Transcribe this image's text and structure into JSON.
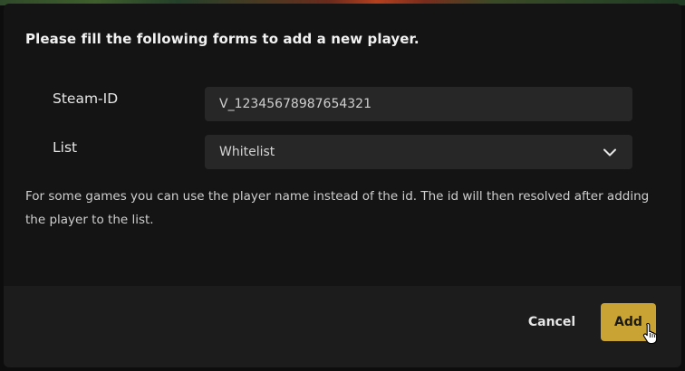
{
  "dialog": {
    "title": "Please fill the following forms to add a new player.",
    "steam_id": {
      "label": "Steam-ID",
      "value": "V_12345678987654321"
    },
    "list": {
      "label": "List",
      "selected": "Whitelist"
    },
    "help_text": "For some games you can use the player name instead of the id. The id will then resolved after adding the player to the list.",
    "buttons": {
      "cancel": "Cancel",
      "add": "Add"
    }
  },
  "colors": {
    "modal_bg": "#141414",
    "footer_bg": "#1c1c1c",
    "input_bg": "#272727",
    "accent": "#c9a333"
  },
  "icons": {
    "select": "chevron-down-icon",
    "cursor": "hand-pointer-icon"
  }
}
